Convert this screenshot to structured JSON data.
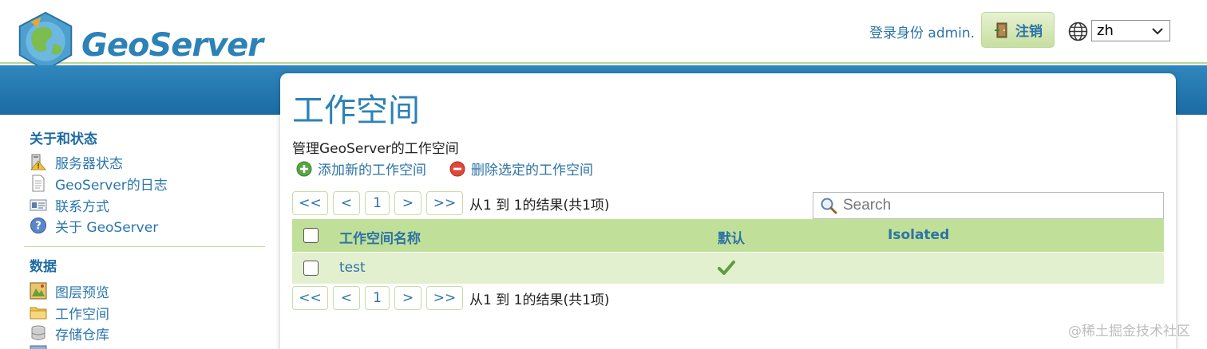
{
  "header": {
    "logo_text": "GeoServer",
    "login_text": "登录身份 admin.",
    "logout_label": "注销",
    "language": "zh"
  },
  "sidebar": {
    "sections": [
      {
        "title": "关于和状态",
        "items": [
          {
            "label": "服务器状态",
            "icon": "server-status-icon"
          },
          {
            "label": "GeoServer的日志",
            "icon": "log-document-icon"
          },
          {
            "label": "联系方式",
            "icon": "contact-card-icon"
          },
          {
            "label": "关于 GeoServer",
            "icon": "help-icon"
          }
        ]
      },
      {
        "title": "数据",
        "items": [
          {
            "label": "图层预览",
            "icon": "layer-preview-icon"
          },
          {
            "label": "工作空间",
            "icon": "folder-icon"
          },
          {
            "label": "存储仓库",
            "icon": "database-icon"
          }
        ]
      }
    ]
  },
  "main": {
    "title": "工作空间",
    "subtitle": "管理GeoServer的工作空间",
    "actions": {
      "add": "添加新的工作空间",
      "remove": "删除选定的工作空间"
    },
    "pager": {
      "first": "<<",
      "prev": "<",
      "page": "1",
      "next": ">",
      "last": ">>",
      "summary": "从1 到 1的结果(共1项)"
    },
    "search": {
      "placeholder": "Search",
      "value": ""
    },
    "table": {
      "columns": [
        "工作空间名称",
        "默认",
        "Isolated"
      ],
      "rows": [
        {
          "name": "test",
          "default": true,
          "isolated": false
        }
      ]
    }
  },
  "watermark": "@稀土掘金技术社区",
  "colors": {
    "brand_blue": "#2c82b6",
    "band_blue": "#2679b1",
    "table_header_green": "#c0df98",
    "table_row_green": "#e3f0cf"
  }
}
